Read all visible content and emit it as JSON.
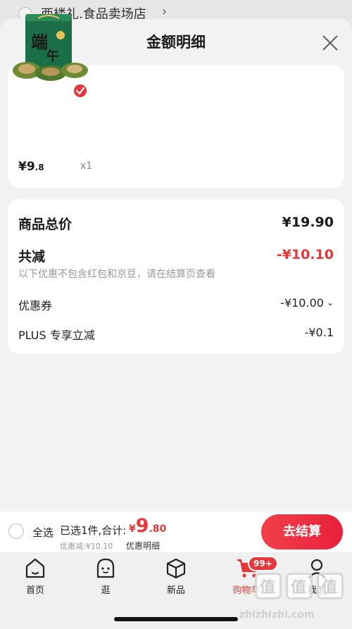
{
  "peek": {
    "shop_name": "西楼礼.食品卖场店"
  },
  "sheet": {
    "title": "金额明细"
  },
  "product": {
    "price_symbol": "¥",
    "price_int": "9",
    "price_dec": ".8",
    "quantity": "x1",
    "thumbnail_text": "端午"
  },
  "details": {
    "total_label": "商品总价",
    "total_value": "¥19.90",
    "reduce_label": "共减",
    "reduce_value": "-¥10.10",
    "note": "以下优惠不包含红包和京豆，请在结算页查看",
    "coupon_label": "优惠券",
    "coupon_value": "-¥10.00",
    "plus_label": "PLUS 专享立减",
    "plus_value": "-¥0.1"
  },
  "checkout": {
    "select_all": "全选",
    "summary": "已选1件,合计:",
    "amount_symbol": "¥",
    "amount_int": "9",
    "amount_dec": ".80",
    "discount": "优惠减:¥10.10",
    "detail_link": "优惠明细",
    "pay_button": "去结算"
  },
  "tabs": [
    {
      "label": "首页",
      "icon": "home-icon"
    },
    {
      "label": "逛",
      "icon": "face-icon"
    },
    {
      "label": "新品",
      "icon": "cube-icon"
    },
    {
      "label": "购物车",
      "icon": "cart-icon",
      "badge": "99+",
      "active": true
    },
    {
      "label": "我的",
      "icon": "user-icon"
    }
  ],
  "watermark": {
    "glyphs": [
      "值",
      "值",
      "值"
    ],
    "text": "zhizhizhi.com"
  },
  "colors": {
    "accent": "#e4393c",
    "background": "#f2f2f2",
    "card": "#ffffff"
  }
}
